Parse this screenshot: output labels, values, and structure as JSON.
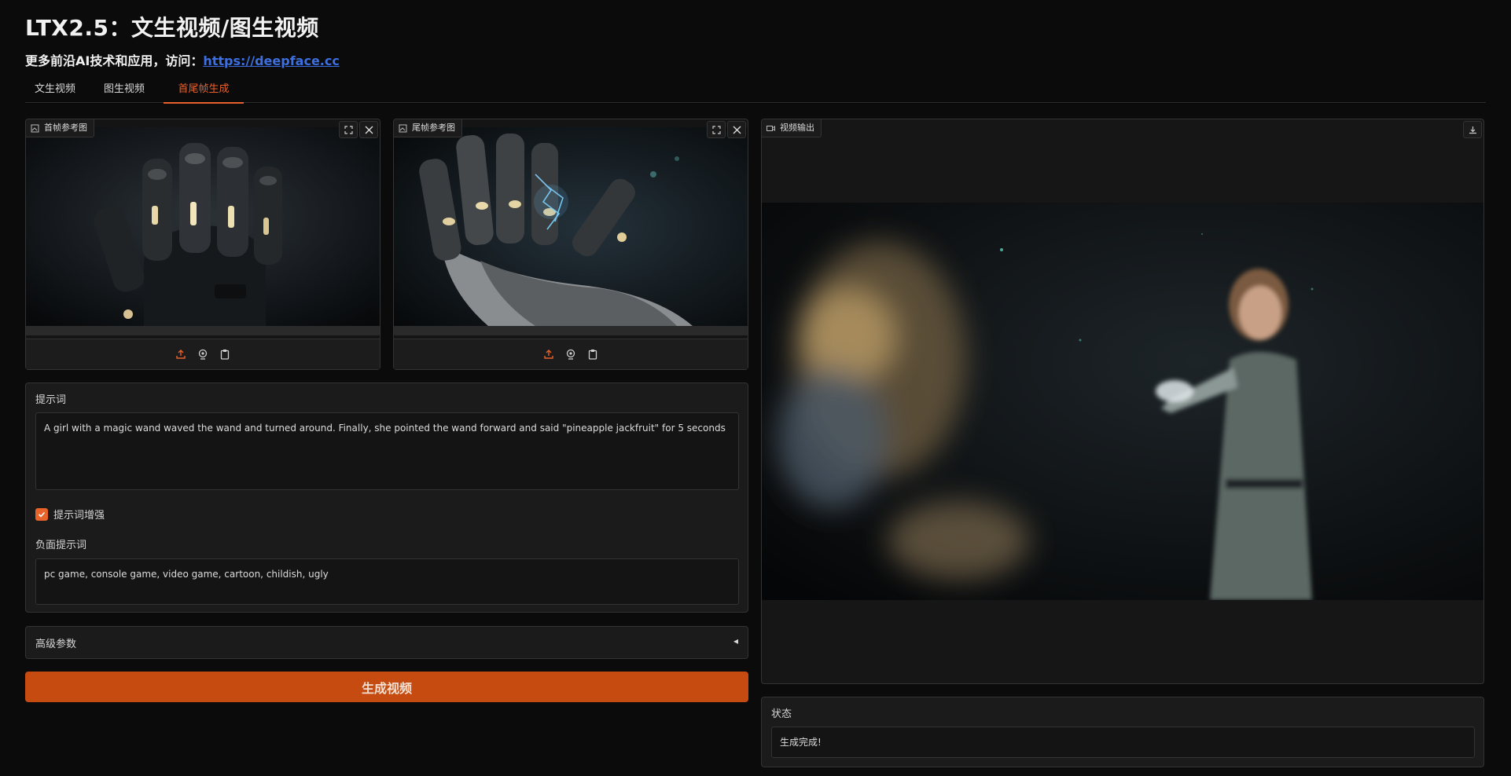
{
  "header": {
    "title": "LTX2.5：文生视频/图生视频",
    "subtitle_prefix": "更多前沿AI技术和应用，访问：",
    "subtitle_link": "https://deepface.cc"
  },
  "tabs": [
    {
      "label": "文生视频"
    },
    {
      "label": "图生视频"
    },
    {
      "label": "首尾帧生成"
    }
  ],
  "first_frame": {
    "label": "首帧参考图"
  },
  "last_frame": {
    "label": "尾帧参考图"
  },
  "video_output": {
    "label": "视频输出"
  },
  "prompt": {
    "label": "提示词",
    "value": "A girl with a magic wand waved the wand and turned around. Finally, she pointed the wand forward and said \"pineapple jackfruit\" for 5 seconds"
  },
  "enhance": {
    "label": "提示词增强",
    "checked": true
  },
  "negative": {
    "label": "负面提示词",
    "value": "pc game, console game, video game, cartoon, childish, ugly"
  },
  "advanced": {
    "label": "高级参数",
    "arrow": "◂"
  },
  "generate_button": {
    "label": "生成视频"
  },
  "status": {
    "label": "状态",
    "value": "生成完成!"
  },
  "colors": {
    "accent": "#e8602c",
    "button": "#c54b10",
    "link": "#3d6fe0"
  }
}
